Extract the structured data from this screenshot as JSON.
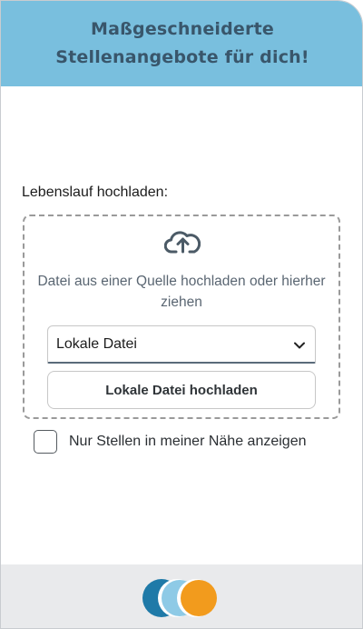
{
  "header": {
    "title_line1": "Maßgeschneiderte",
    "title_line2": "Stellenangebote für dich!"
  },
  "upload": {
    "label": "Lebenslauf hochladen:",
    "hint": "Datei aus einer Quelle hochladen oder hierher ziehen",
    "source_select": {
      "selected": "Lokale Datei"
    },
    "upload_button_label": "Lokale Datei hochladen"
  },
  "filters": {
    "nearby_label": "Nur Stellen in meiner Nähe anzeigen",
    "nearby_checked": false
  },
  "icons": {
    "upload": "cloud-upload-icon",
    "dropdown": "chevron-down-icon"
  },
  "colors": {
    "header_bg": "#79bfde",
    "header_text": "#39566b",
    "footer_bg": "#e9eaec",
    "logo_dark_blue": "#1f7aa8",
    "logo_light_blue": "#8ecae6",
    "logo_orange": "#f29b1d"
  }
}
